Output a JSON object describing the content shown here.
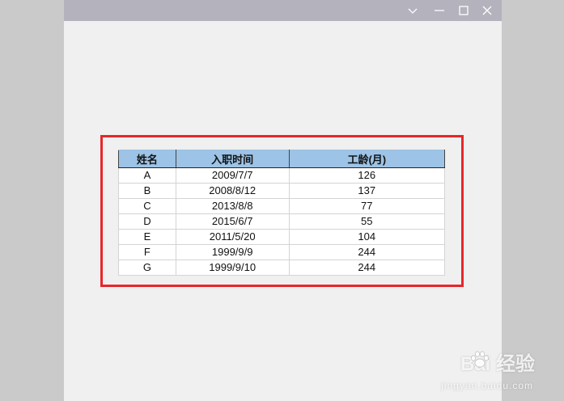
{
  "window": {
    "controls": [
      "chevron-down-icon",
      "minimize-icon",
      "maximize-icon",
      "close-icon"
    ]
  },
  "table": {
    "headers": [
      "姓名",
      "入职时间",
      "工龄(月)"
    ],
    "rows": [
      [
        "A",
        "2009/7/7",
        "126"
      ],
      [
        "B",
        "2008/8/12",
        "137"
      ],
      [
        "C",
        "2013/8/8",
        "77"
      ],
      [
        "D",
        "2015/6/7",
        "55"
      ],
      [
        "E",
        "2011/5/20",
        "104"
      ],
      [
        "F",
        "1999/9/9",
        "244"
      ],
      [
        "G",
        "1999/9/10",
        "244"
      ]
    ]
  },
  "watermark": {
    "main": "Bai  经验",
    "sub": "jingyan.baidu.com"
  },
  "colors": {
    "titlebar": "#b4b2bd",
    "header_fill": "#9dc3e6",
    "highlight_border": "#e8262a"
  }
}
